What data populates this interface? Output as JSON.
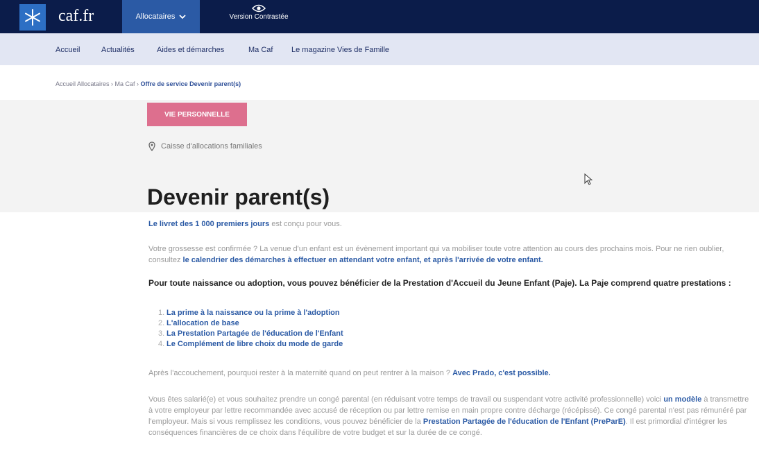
{
  "header": {
    "brand": "caf.fr",
    "allocataires_menu": "Allocataires",
    "contrast_label": "Version Contrastée"
  },
  "nav": {
    "items": [
      "Accueil",
      "Actualités",
      "Aides et démarches",
      "Ma Caf",
      "Le magazine Vies de Famille"
    ]
  },
  "breadcrumb": {
    "text": "Accueil Allocataires › Ma Caf › ",
    "current": "Offre de service Devenir parent(s)"
  },
  "hero": {
    "category_button": "VIE PERSONNELLE",
    "source_label": "Caisse d'allocations familiales"
  },
  "article": {
    "title": "Devenir parent(s)",
    "lead_link": "Le livret des 1 000 premiers jours",
    "lead_rest": " est conçu pour vous.",
    "p1_a": "Votre grossesse est confirmée ? La venue d'un enfant est un évènement important qui va mobiliser toute votre attention au cours des prochains mois. Pour ne rien oublier, consultez ",
    "p1_link": "le calendrier des démarches à effectuer en attendant votre enfant, et après l'arrivée de votre enfant.",
    "p2": "Pour toute naissance ou adoption, vous pouvez bénéficier de la Prestation d'Accueil du Jeune Enfant (Paje). La Paje comprend quatre prestations :",
    "list": [
      "La prime à la naissance ou la prime à l'adoption",
      "L'allocation de base",
      "La Prestation Partagée de l'éducation de l'Enfant",
      "Le Complément de libre choix du mode de garde"
    ],
    "p3_a": "Après l'accouchement, pourquoi rester à la maternité quand on peut rentrer à la maison ? ",
    "p3_link": "Avec Prado, c'est possible.",
    "p4_a": "Vous êtes salarié(e) et vous souhaitez prendre un congé parental (en réduisant votre temps de travail ou suspendant votre activité professionnelle) voici ",
    "p4_link1": "un modèle",
    "p4_b": " à transmettre à votre employeur par lettre recommandée avec accusé de réception ou par lettre remise en main propre contre décharge (récépissé). Ce congé parental n'est pas rémunéré par l'employeur. Mais si vous remplissez les conditions, vous pouvez bénéficier de la ",
    "p4_link2": "Prestation Partagée de l'éducation de l'Enfant (PreParE)",
    "p4_c": ". Il est primordial d'intégrer les conséquences financières de ce choix dans l'équilibre de votre budget et sur la durée de ce congé."
  },
  "colors": {
    "topbar": "#0b1c4a",
    "nav_bg": "#e2e6f3",
    "accent_blue": "#2b5aa5",
    "category_pink": "#dd6f8e"
  },
  "icons": [
    "snowflake-logo-icon",
    "chevron-down-icon",
    "eye-icon",
    "location-pin-icon",
    "mouse-cursor-icon"
  ]
}
